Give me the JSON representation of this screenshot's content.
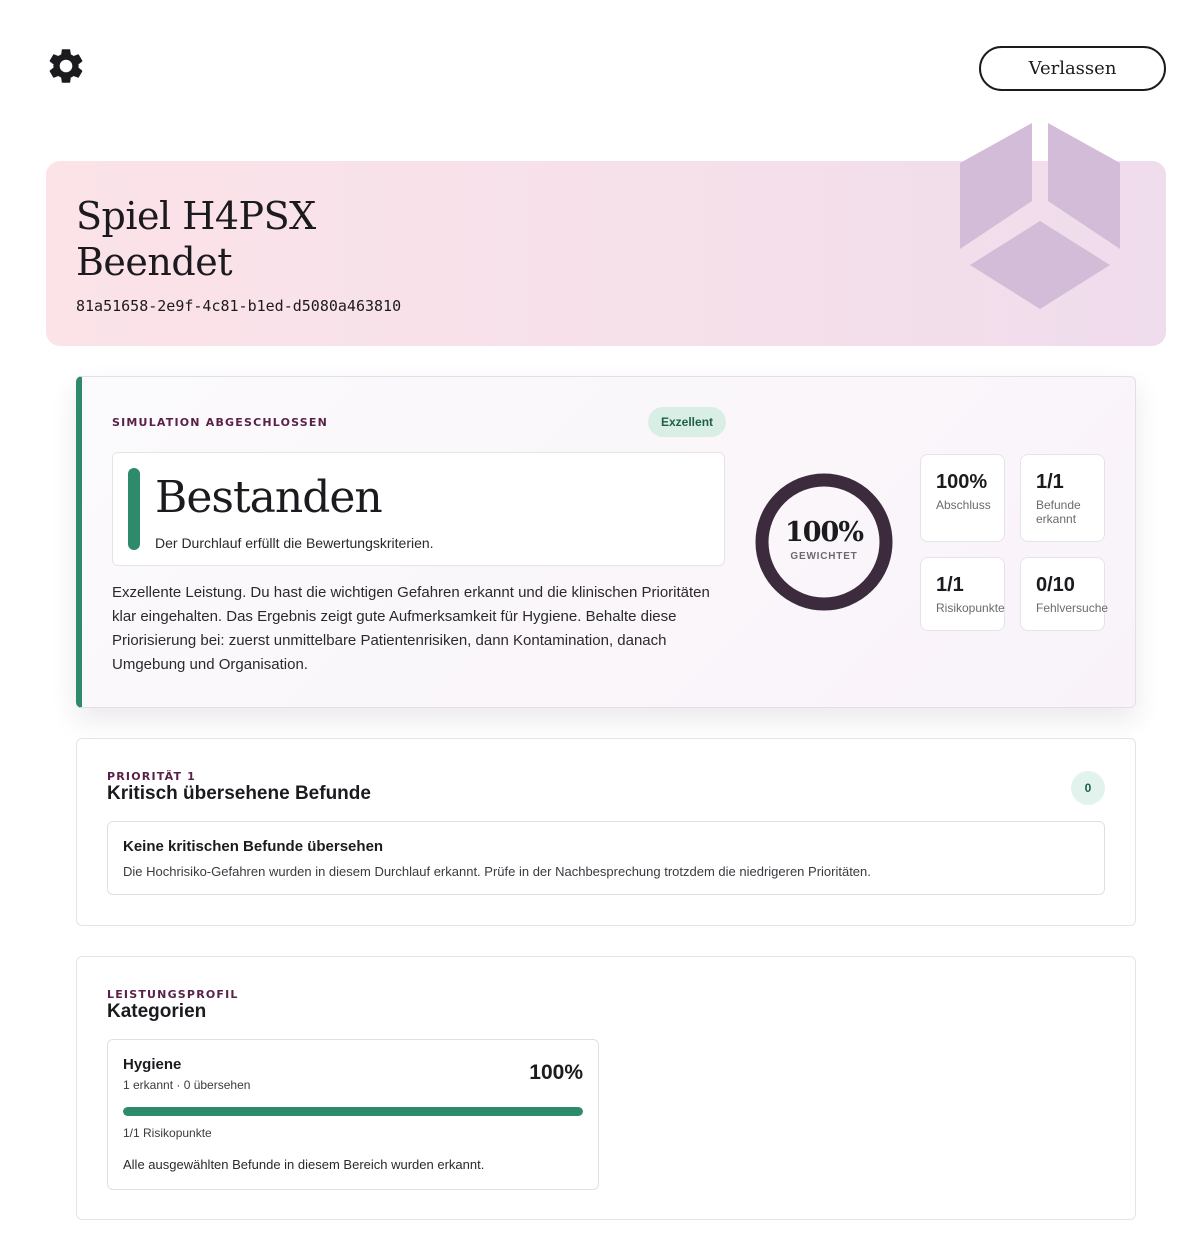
{
  "topbar": {
    "settings_icon": "gear-icon",
    "leave_label": "Verlassen"
  },
  "hero": {
    "title_line1": "Spiel H4PSX",
    "title_line2": "Beendet",
    "game_id": "81a51658-2e9f-4c81-b1ed-d5080a463810",
    "logo_icon": "cube-logo-icon",
    "logo_color": "#d3bcd8"
  },
  "result": {
    "eyebrow": "Simulation abgeschlossen",
    "badge": "Exzellent",
    "verdict_title": "Bestanden",
    "verdict_subtitle": "Der Durchlauf erfüllt die Bewertungskriterien.",
    "description": "Exzellente Leistung. Du hast die wichtigen Gefahren erkannt und die klinischen Prioritäten klar eingehalten. Das Ergebnis zeigt gute Aufmerksamkeit für Hygiene. Behalte diese Priorisierung bei: zuerst unmittelbare Patientenrisiken, dann Kontamination, danach Umgebung und Organisation.",
    "score_value": "100%",
    "score_fraction": 1.0,
    "score_label": "GEWICHTET",
    "stats": [
      {
        "value": "100%",
        "label": "Abschluss"
      },
      {
        "value": "1/1",
        "label": "Befunde erkannt"
      },
      {
        "value": "1/1",
        "label": "Risikopunkte"
      },
      {
        "value": "0/10",
        "label": "Fehlversuche"
      }
    ],
    "accent_color": "#2d8a6b",
    "ring_color": "#3c2a3d"
  },
  "priority": {
    "eyebrow": "Priorität 1",
    "title": "Kritisch übersehene Befunde",
    "count": "0",
    "info_title": "Keine kritischen Befunde übersehen",
    "info_text": "Die Hochrisiko-Gefahren wurden in diesem Durchlauf erkannt. Prüfe in der Nachbesprechung trotzdem die niedrigeren Prioritäten."
  },
  "performance": {
    "eyebrow": "Leistungsprofil",
    "title": "Kategorien",
    "categories": [
      {
        "name": "Hygiene",
        "counts": "1 erkannt · 0 übersehen",
        "percent_label": "100%",
        "fraction": 1.0,
        "points": "1/1 Risikopunkte",
        "note": "Alle ausgewählten Befunde in diesem Bereich wurden erkannt."
      }
    ]
  }
}
